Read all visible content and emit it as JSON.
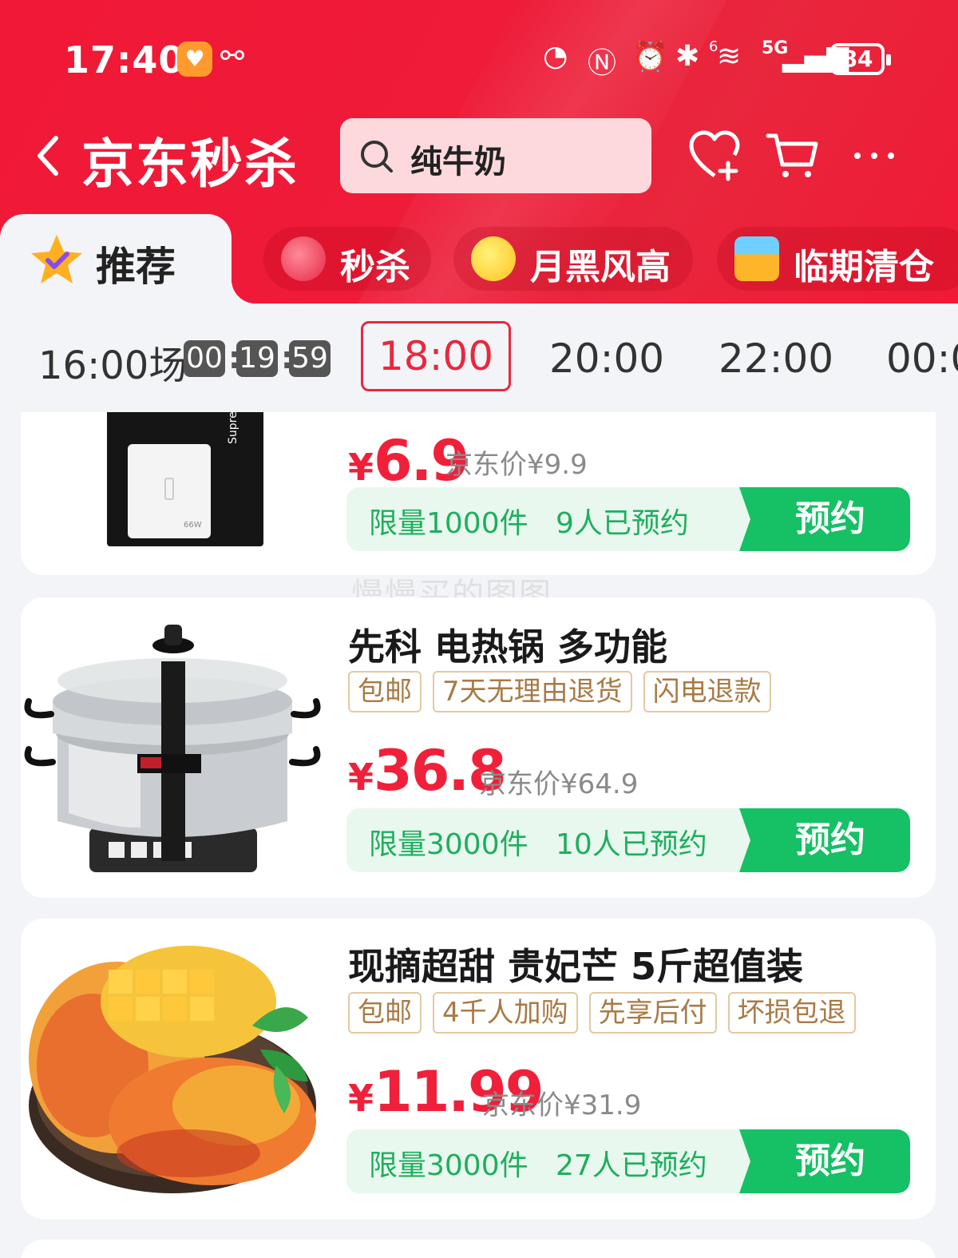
{
  "status_bar": {
    "time": "17:40",
    "network": "5G",
    "signal_superscript": "6",
    "battery": "84"
  },
  "nav": {
    "title_part1": "京东秒",
    "title_part2": "杀",
    "search_placeholder": "纯牛奶"
  },
  "categories": [
    {
      "label": "推荐",
      "icon": "star-check-icon",
      "active": true
    },
    {
      "label": "秒杀",
      "icon": "alarm-clock-icon"
    },
    {
      "label": "月黑风高",
      "icon": "moon-icon"
    },
    {
      "label": "临期清仓",
      "icon": "basket-icon"
    }
  ],
  "time_slots": {
    "current_label": "16:00场",
    "countdown": [
      "00",
      "19",
      "59"
    ],
    "slots": [
      "18:00",
      "20:00",
      "22:00",
      "00:0"
    ]
  },
  "products": [
    {
      "name": "",
      "price_symbol": "¥",
      "price": "6.9",
      "jd_price": "京东价¥9.9",
      "limit": "限量1000件",
      "reserved": "9人已预约",
      "button": "预约"
    },
    {
      "name": "先科 电热锅 多功能",
      "tags": [
        "包邮",
        "7天无理由退货",
        "闪电退款"
      ],
      "price_symbol": "¥",
      "price": "36.8",
      "jd_price": "京东价¥64.9",
      "limit": "限量3000件",
      "reserved": "10人已预约",
      "button": "预约"
    },
    {
      "name": "现摘超甜 贵妃芒 5斤超值装",
      "tags": [
        "包邮",
        "4千人加购",
        "先享后付",
        "坏损包退"
      ],
      "price_symbol": "¥",
      "price": "11.99",
      "jd_price": "京东价¥31.9",
      "limit": "限量3000件",
      "reserved": "27人已预约",
      "button": "预约"
    }
  ],
  "product_image_text": {
    "charger_box": "Supre Ch",
    "charger_watt": "66W"
  },
  "watermark": "慢慢买的图图",
  "colors": {
    "brand_red": "#f01836",
    "price_red": "#f0203a",
    "reserve_green": "#16c065",
    "tag_gold": "#a87a45"
  }
}
